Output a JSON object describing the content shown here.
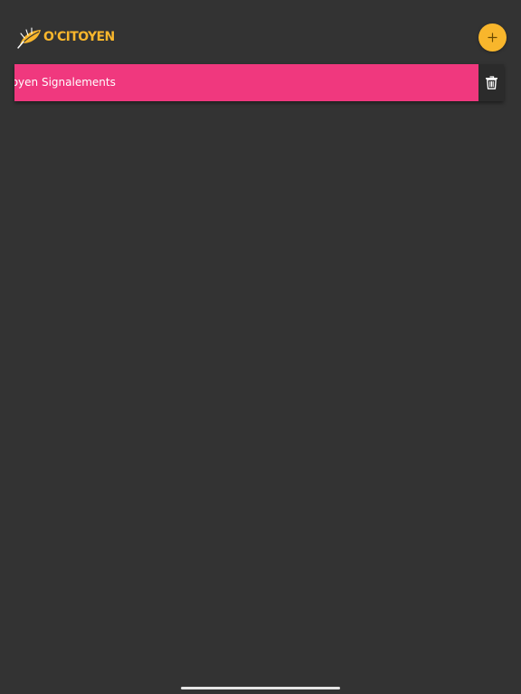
{
  "app": {
    "logo_text": "O'CITOYEN",
    "logo_icon": "leaf-logo-icon"
  },
  "header": {
    "add_icon": "plus-icon"
  },
  "list": {
    "items": [
      {
        "label": "O'Citoyen Signalements",
        "visible_label": "toyen Signalements",
        "delete_icon": "trash-icon"
      }
    ]
  },
  "colors": {
    "background": "#333333",
    "accent": "#F8B62C",
    "row": "#F0387E",
    "delete_bg": "#2B2B2B"
  }
}
